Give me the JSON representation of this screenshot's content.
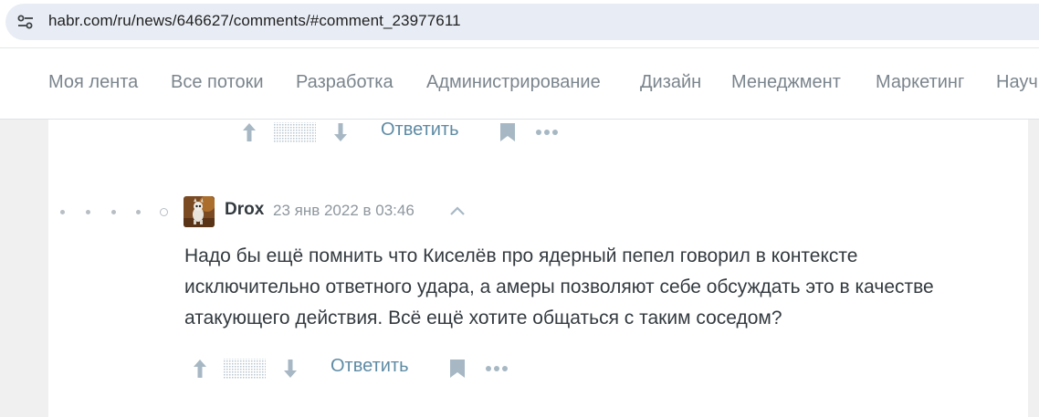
{
  "browser": {
    "url": "habr.com/ru/news/646627/comments/#comment_23977611"
  },
  "nav": {
    "items": [
      "Моя лента",
      "Все потоки",
      "Разработка",
      "Администрирование",
      "Дизайн",
      "Менеджмент",
      "Маркетинг",
      "Научпоп"
    ]
  },
  "previous_comment": {
    "reply_label": "Ответить"
  },
  "comment": {
    "author": "Drox",
    "date": "23 янв 2022 в 03:46",
    "text": "Надо бы ещё помнить что Киселёв про ядерный пепел говорил в контексте исключительно ответного удара, а амеры позволяют себе обсуждать это в качестве атакующего действия. Всё ещё хотите общаться с таким соседом?",
    "reply_label": "Ответить"
  },
  "icons": {
    "site_settings": "tune-icon",
    "vote_up": "arrow-up-icon",
    "vote_down": "arrow-down-icon",
    "score_hidden": "dotted-score-placeholder",
    "bookmark": "bookmark-icon",
    "more": "more-dots-icon",
    "collapse": "chevron-up-icon"
  },
  "colors": {
    "nav_text": "#7b858d",
    "link": "#5e8ba4",
    "icon": "#a7b8c4",
    "text": "#333a3f",
    "muted": "#8e979e",
    "page_bg": "#f0f0f0",
    "urlbar_bg": "#e8edf5"
  }
}
